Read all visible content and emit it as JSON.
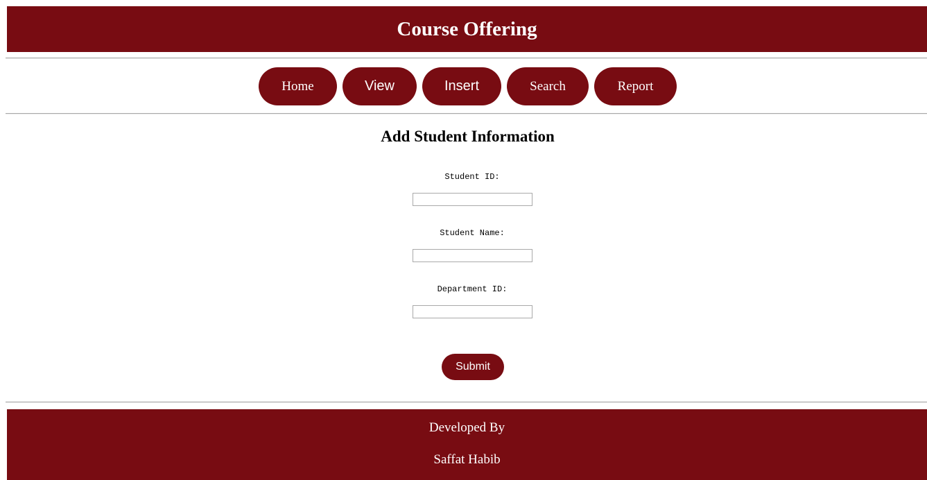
{
  "header": {
    "title": "Course Offering"
  },
  "nav": {
    "items": [
      {
        "label": "Home"
      },
      {
        "label": "View"
      },
      {
        "label": "Insert"
      },
      {
        "label": "Search"
      },
      {
        "label": "Report"
      }
    ]
  },
  "form": {
    "title": "Add Student Information",
    "fields": [
      {
        "label": "Student ID:",
        "value": "",
        "placeholder": ""
      },
      {
        "label": "Student Name:",
        "value": "",
        "placeholder": ""
      },
      {
        "label": "Department ID:",
        "value": "",
        "placeholder": ""
      }
    ],
    "submit_label": "Submit"
  },
  "footer": {
    "line1": "Developed By",
    "line2": "Saffat Habib"
  },
  "colors": {
    "brand": "#780c12",
    "text_on_brand": "#ffffff",
    "divider": "#a8a8a8"
  }
}
